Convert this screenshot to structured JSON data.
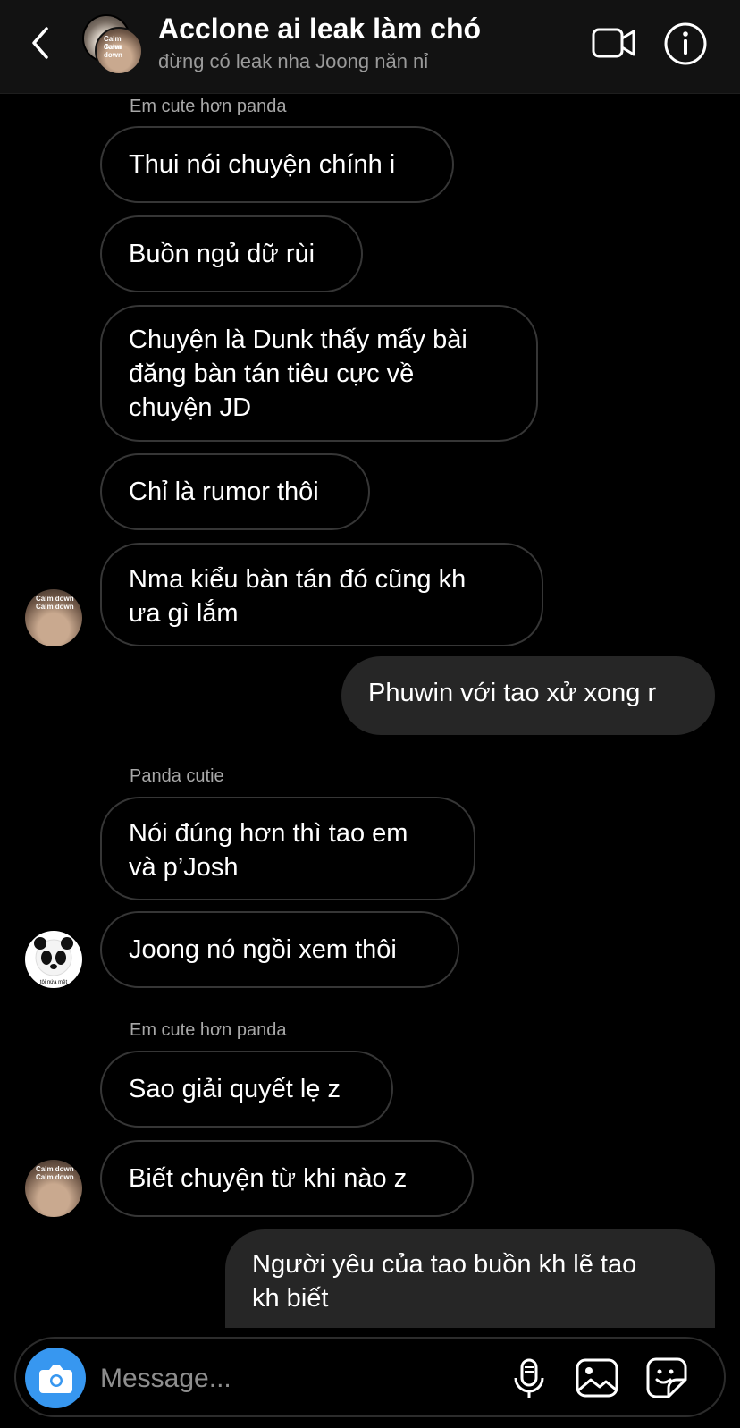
{
  "header": {
    "title": "Acclone ai leak làm chó",
    "subtitle": "đừng có leak nha Joong năn nỉ",
    "avatar_caption": "Calm down"
  },
  "messages": [
    {
      "type": "sender",
      "text": "Em cute hơn panda"
    },
    {
      "type": "in",
      "text": "Thui nói chuyện chính i"
    },
    {
      "type": "in",
      "text": "Buồn ngủ dữ rùi"
    },
    {
      "type": "in",
      "lines": [
        "Chuyện là Dunk thấy mấy bài",
        "đăng bàn tán tiêu cực về",
        "chuyện JD"
      ]
    },
    {
      "type": "in",
      "text": "Chỉ là rumor thôi"
    },
    {
      "type": "in",
      "lines": [
        "Nma kiểu bàn tán đó cũng kh",
        "ưa gì lắm"
      ]
    },
    {
      "type": "out",
      "text": "Phuwin với tao xử xong r"
    },
    {
      "type": "sender",
      "text": "Panda cutie"
    },
    {
      "type": "in",
      "lines": [
        "Nói đúng hơn thì tao em",
        "và p’Josh"
      ]
    },
    {
      "type": "in",
      "text": "Joong nó ngồi xem thôi"
    },
    {
      "type": "sender",
      "text": "Em cute hơn panda"
    },
    {
      "type": "in",
      "text": "Sao giải quyết lẹ z"
    },
    {
      "type": "in",
      "text": "Biết chuyện từ khi nào z"
    },
    {
      "type": "out",
      "lines": [
        "Người yêu của tao buồn kh lẽ tao",
        "kh biết"
      ]
    }
  ],
  "avatar_captions": {
    "boy": "Calm down",
    "panda": "tôi nứa mệt"
  },
  "composer": {
    "placeholder": "Message..."
  },
  "colors": {
    "accent": "#3797f0",
    "outgoing_bubble": "#262626",
    "incoming_border": "#363636"
  }
}
